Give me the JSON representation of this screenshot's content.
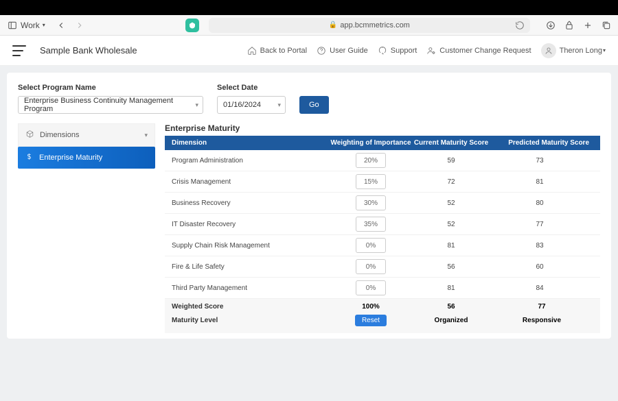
{
  "browser": {
    "work_label": "Work",
    "url": "app.bcmmetrics.com"
  },
  "header": {
    "org_name": "Sample Bank Wholesale",
    "links": {
      "back": "Back to Portal",
      "guide": "User Guide",
      "support": "Support",
      "change": "Customer Change Request"
    },
    "user_name": "Theron Long"
  },
  "filters": {
    "program_label": "Select Program Name",
    "program_value": "Enterprise Business Continuity Management Program",
    "date_label": "Select Date",
    "date_value": "01/16/2024",
    "go_label": "Go"
  },
  "sidebar": {
    "dimensions_label": "Dimensions",
    "enterprise_label": "Enterprise Maturity"
  },
  "table": {
    "title": "Enterprise Maturity",
    "headers": {
      "dimension": "Dimension",
      "weight": "Weighting of Importance",
      "current": "Current Maturity Score",
      "predicted": "Predicted Maturity Score"
    },
    "rows": [
      {
        "dimension": "Program Administration",
        "weight": "20%",
        "current": "59",
        "predicted": "73"
      },
      {
        "dimension": "Crisis Management",
        "weight": "15%",
        "current": "72",
        "predicted": "81"
      },
      {
        "dimension": "Business Recovery",
        "weight": "30%",
        "current": "52",
        "predicted": "80"
      },
      {
        "dimension": "IT Disaster Recovery",
        "weight": "35%",
        "current": "52",
        "predicted": "77"
      },
      {
        "dimension": "Supply Chain Risk Management",
        "weight": "0%",
        "current": "81",
        "predicted": "83"
      },
      {
        "dimension": "Fire & Life Safety",
        "weight": "0%",
        "current": "56",
        "predicted": "60"
      },
      {
        "dimension": "Third Party Management",
        "weight": "0%",
        "current": "81",
        "predicted": "84"
      }
    ],
    "footer": {
      "weighted_label": "Weighted Score",
      "weighted_total": "100%",
      "weighted_current": "56",
      "weighted_predicted": "77",
      "maturity_label": "Maturity Level",
      "reset_label": "Reset",
      "maturity_current": "Organized",
      "maturity_predicted": "Responsive"
    }
  }
}
